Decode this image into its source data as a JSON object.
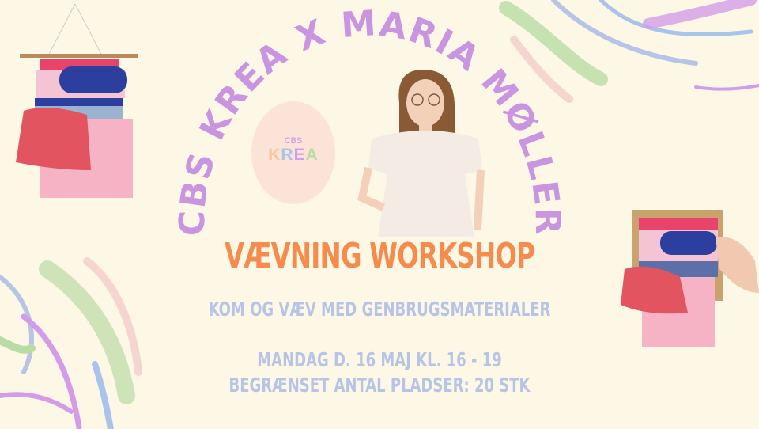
{
  "arc_title": "CBS KREA X  MARIA MØLLER",
  "logo": {
    "small": "CBS",
    "letters": [
      "K",
      "R",
      "E",
      "A"
    ],
    "letter_colors": [
      "#f6c69d",
      "#a9c3ea",
      "#d49ce8",
      "#b9dca4"
    ]
  },
  "headline": "VÆVNING WORKSHOP",
  "subtitle": "KOM OG VÆV MED GENBRUGSMATERIALER",
  "date_line": "MANDAG D. 16 MAJ KL. 16 - 19",
  "capacity_line": "BEGRÆNSET ANTAL PLADSER: 20 STK",
  "colors": {
    "background": "#fdf7e6",
    "arc": "#c994e0",
    "headline": "#f58b4c",
    "info": "#b7c4e6"
  }
}
